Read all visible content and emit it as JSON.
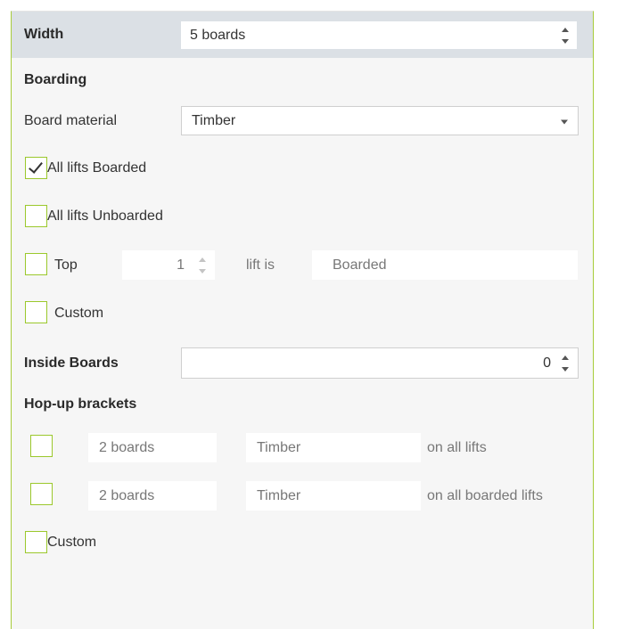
{
  "width": {
    "label": "Width",
    "value": "5 boards"
  },
  "boarding": {
    "heading": "Boarding",
    "material_label": "Board material",
    "material_value": "Timber",
    "all_boarded": {
      "label": "All lifts Boarded",
      "checked": true
    },
    "all_unboarded": {
      "label": "All lifts Unboarded",
      "checked": false
    },
    "top": {
      "label": "Top",
      "count": "1",
      "mid_label": "lift is",
      "state": "Boarded",
      "checked": false
    },
    "custom": {
      "label": "Custom",
      "checked": false
    }
  },
  "inside_boards": {
    "label": "Inside Boards",
    "value": "0"
  },
  "hopup": {
    "heading": "Hop-up brackets",
    "rows": [
      {
        "boards": "2 boards",
        "material": "Timber",
        "scope": "on all lifts",
        "checked": false
      },
      {
        "boards": "2 boards",
        "material": "Timber",
        "scope": "on all boarded lifts",
        "checked": false
      }
    ],
    "custom": {
      "label": "Custom",
      "checked": false
    }
  },
  "colors": {
    "accent_border": "#9bc82c",
    "header_band": "#dbe0e5",
    "panel_bg": "#f6f6f6"
  }
}
